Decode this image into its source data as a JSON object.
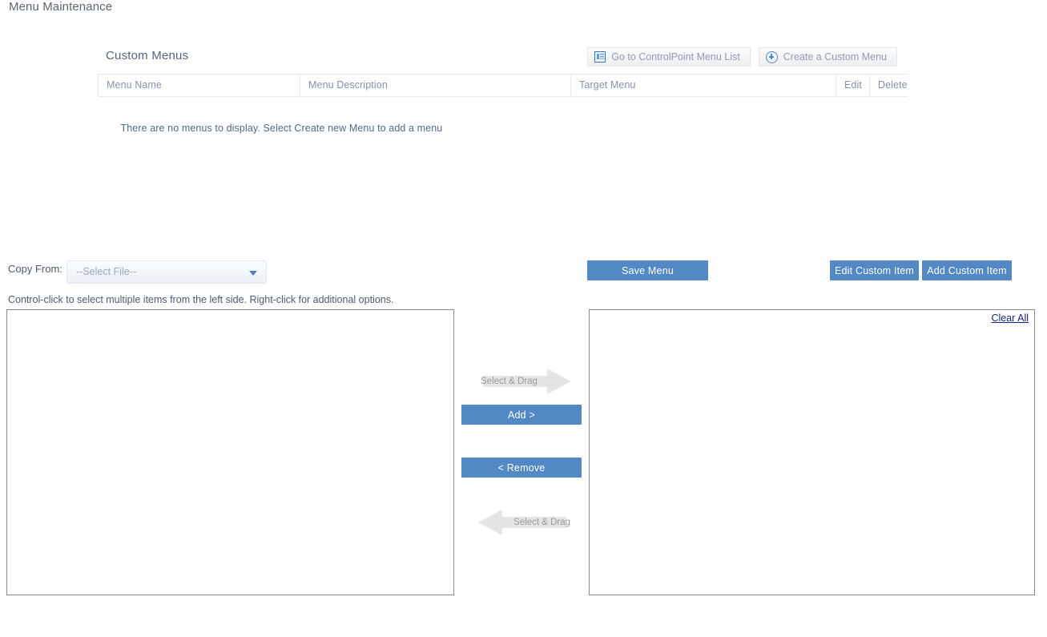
{
  "page": {
    "title": "Menu Maintenance"
  },
  "custom_menus": {
    "section_title": "Custom Menus",
    "toolbar": {
      "go_to_list_label": "Go to ControlPoint Menu List",
      "create_menu_label": "Create a Custom Menu"
    },
    "table": {
      "columns": [
        "Menu Name",
        "Menu Description",
        "Target Menu",
        "Edit",
        "Delete"
      ],
      "rows": [],
      "empty_message": "There are no menus to display. Select Create new Menu to add a menu"
    }
  },
  "copy_from": {
    "label": "Copy From:",
    "selected_value": "--Select File--"
  },
  "hint": {
    "text": "Control-click to select multiple items from the left side. Right-click for additional options."
  },
  "actions": {
    "save_menu": "Save Menu",
    "edit_custom_item": "Edit Custom Item",
    "add_custom_item": "Add Custom Item"
  },
  "transfer": {
    "drag_hint_top": "Select & Drag",
    "add_label": "Add >",
    "remove_label": "< Remove",
    "drag_hint_bottom": "Select & Drag"
  },
  "left_list": {
    "items": []
  },
  "right_list": {
    "clear_all_label": "Clear All",
    "items": []
  },
  "colors": {
    "accent_blue": "#5288c4",
    "header_text": "#8691ad",
    "link_blue": "#1a237e",
    "panel_border": "#8b8b8b"
  }
}
